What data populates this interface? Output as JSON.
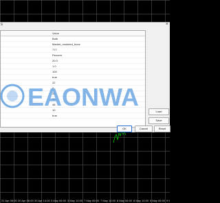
{
  "window": {
    "title_glyph": "s",
    "close_glyph": "×"
  },
  "table": {
    "header": {
      "value": "Value"
    },
    "rows": [
      {
        "value": "Both"
      },
      {
        "value": "Market_modeled_bonz"
      },
      {
        "value": "777"
      },
      {
        "value": "Percent"
      },
      {
        "value": "20.0"
      },
      {
        "value": "1.0"
      },
      {
        "value": "100"
      },
      {
        "value": "true"
      },
      {
        "value": "22"
      },
      {
        "value": "0"
      },
      {
        "value": "23"
      },
      {
        "value": "30"
      },
      {
        "value": "48"
      },
      {
        "value": "10"
      },
      {
        "value": "true"
      }
    ]
  },
  "buttons": {
    "load": "Load",
    "save": "Save",
    "ok": "OK",
    "cancel": "Cancel",
    "reset": "Reset"
  },
  "watermark": {
    "text": "EAONWA"
  },
  "time_axis": {
    "ticks": [
      "21 Apr 06:00",
      "30 Apr 06:00",
      "30 Apr 14:00",
      "3 May 06:00",
      "3 May 14:00",
      "7 May 06:00",
      "7 May 14:00",
      "8 May 06:00",
      "8 May 14:00",
      "9 May 06:00",
      "9 May 14:00"
    ]
  },
  "colors": {
    "accent": "#2b6ccf",
    "price_line": "#00c800",
    "watermark": "#5e9ee0"
  }
}
